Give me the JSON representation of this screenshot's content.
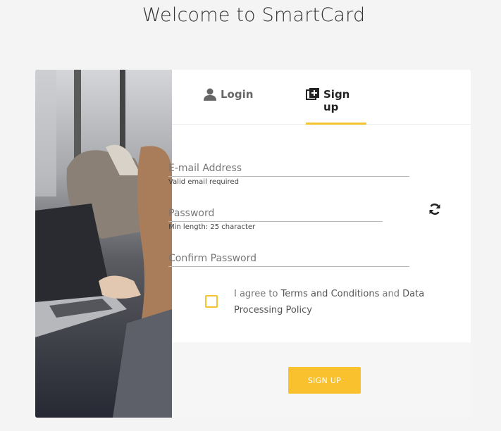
{
  "page": {
    "title": "Welcome to SmartCard"
  },
  "tabs": [
    {
      "label": "Login",
      "icon": "user-icon",
      "active": false
    },
    {
      "label": "Sign up",
      "icon": "add-box-icon",
      "active": true
    }
  ],
  "form": {
    "email": {
      "placeholder": "E-mail Address",
      "value": "",
      "hint": "Valid email required"
    },
    "password": {
      "placeholder": "Password",
      "value": "",
      "hint": "Min length: 25 character"
    },
    "confirm_password": {
      "placeholder": "Confirm Password",
      "value": ""
    },
    "agree": {
      "prefix": "I agree to ",
      "terms_link": "Terms and Conditions",
      "middle": " and ",
      "data_link": "Data Processing Policy",
      "checked": false
    },
    "submit_label": "SIGN UP"
  },
  "colors": {
    "accent": "#f4c430",
    "button": "#f8c12d"
  }
}
